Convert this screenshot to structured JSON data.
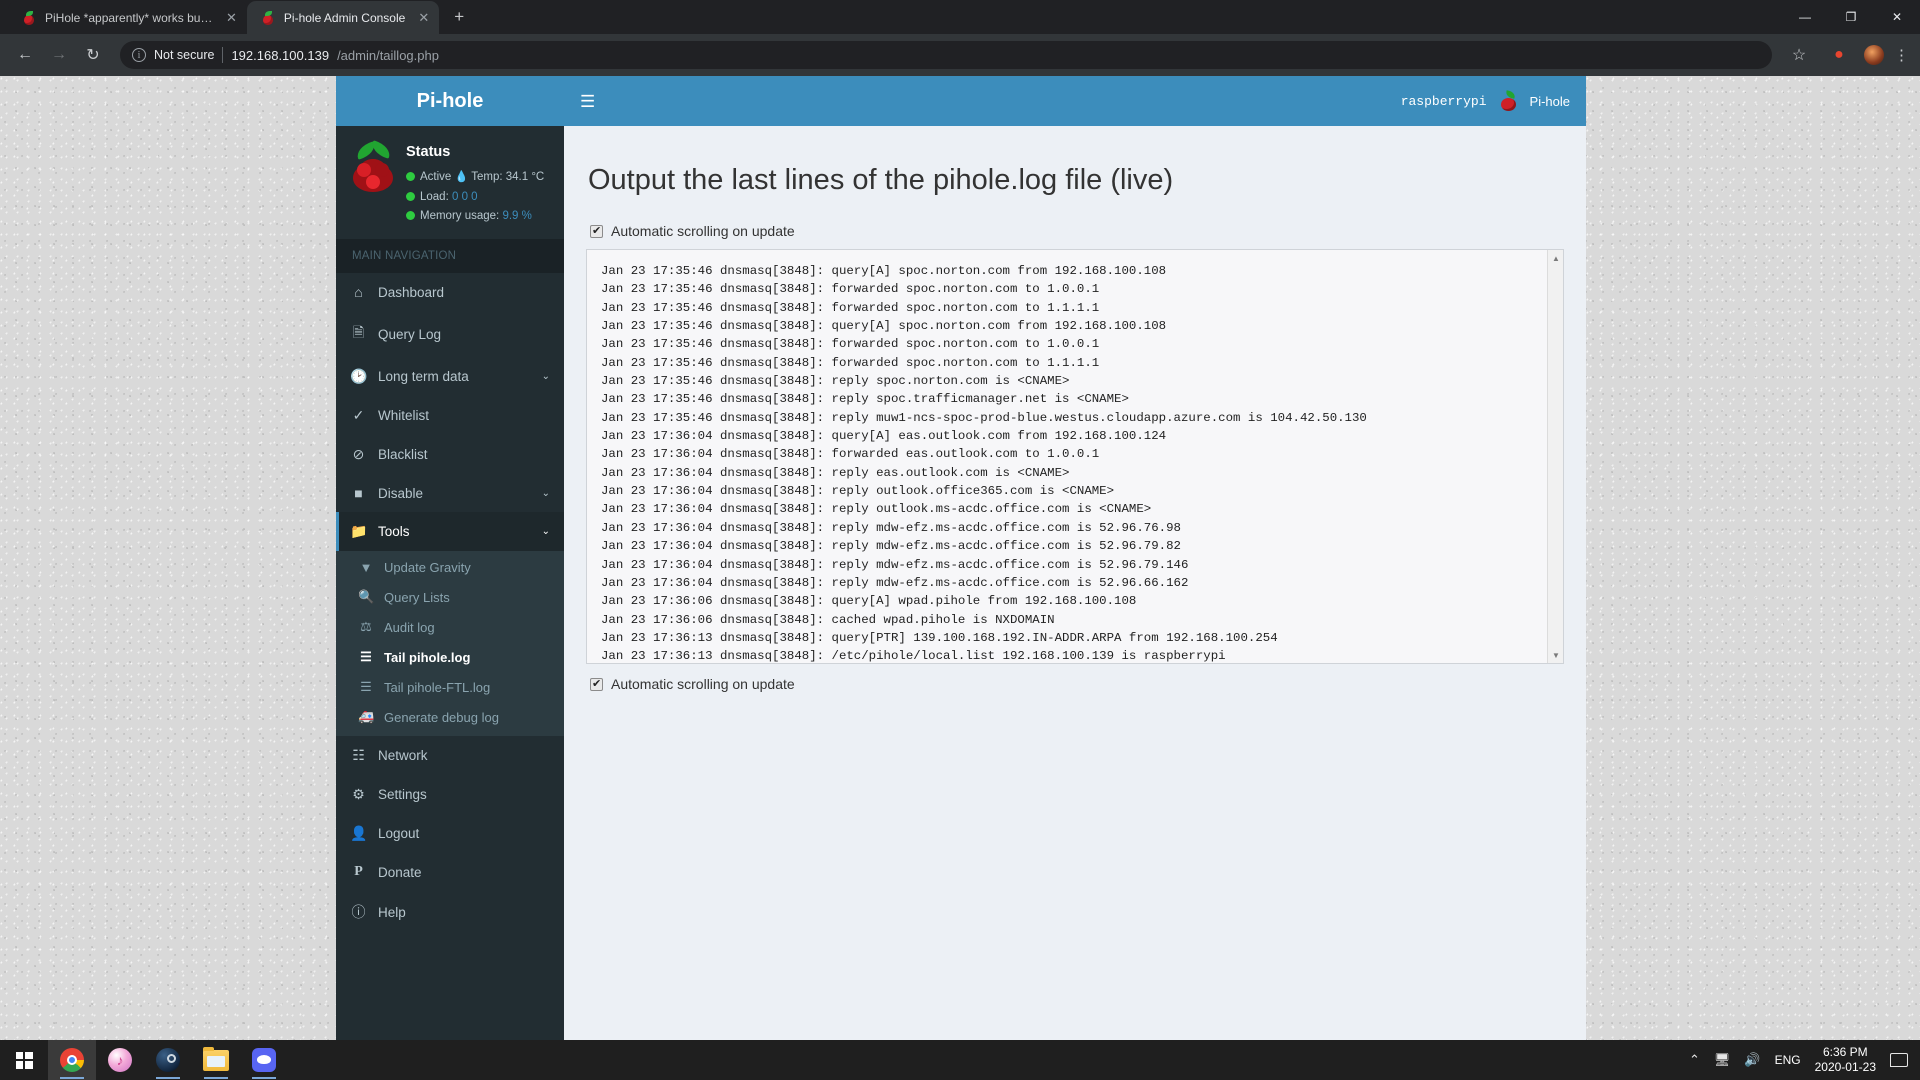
{
  "browser": {
    "tabs": [
      {
        "title": "PiHole *apparently* works but it i",
        "active": false,
        "favicon": "pihole-favicon"
      },
      {
        "title": "Pi-hole Admin Console",
        "active": true,
        "favicon": "pihole-favicon"
      }
    ],
    "new_tab_label": "+",
    "window_controls": {
      "minimize": "—",
      "maximize": "❐",
      "close": "✕"
    },
    "nav": {
      "back": "←",
      "forward": "→",
      "reload": "↻"
    },
    "omnibox": {
      "security_label": "Not secure",
      "info_glyph": "i",
      "url_host": "192.168.100.139",
      "url_path": "/admin/taillog.php"
    },
    "bookmark_star": "☆",
    "menu_dots": "⋮"
  },
  "sidebar": {
    "brand": "Pi-hole",
    "status": {
      "title": "Status",
      "active_label": "Active",
      "temp_label": "Temp: 34.1 °C",
      "load_label": "Load:",
      "load_value": "0  0  0",
      "memory_label": "Memory usage:",
      "memory_value": "9.9 %"
    },
    "nav_header": "MAIN NAVIGATION",
    "items": [
      {
        "label": "Dashboard",
        "icon": "home-icon",
        "glyph": "⌂",
        "caret": ""
      },
      {
        "label": "Query Log",
        "icon": "document-icon",
        "glyph": "὜e",
        "caret": ""
      },
      {
        "label": "Long term data",
        "icon": "clock-icon",
        "glyph": "◴",
        "caret": "⌄"
      },
      {
        "label": "Whitelist",
        "icon": "check-circle-icon",
        "glyph": "✓",
        "caret": ""
      },
      {
        "label": "Blacklist",
        "icon": "ban-icon",
        "glyph": "⊘",
        "caret": ""
      },
      {
        "label": "Disable",
        "icon": "square-icon",
        "glyph": "■",
        "caret": "⌄"
      },
      {
        "label": "Tools",
        "icon": "folder-icon",
        "glyph": "▰",
        "caret": "⌄",
        "open": true
      }
    ],
    "tools_submenu": [
      {
        "label": "Update Gravity",
        "icon": "download-circle-icon",
        "glyph": "⬇",
        "active": false
      },
      {
        "label": "Query Lists",
        "icon": "search-icon",
        "glyph": "⌕",
        "active": false
      },
      {
        "label": "Audit log",
        "icon": "balance-scale-icon",
        "glyph": "⚖",
        "active": false
      },
      {
        "label": "Tail pihole.log",
        "icon": "list-icon",
        "glyph": "≡",
        "active": true
      },
      {
        "label": "Tail pihole-FTL.log",
        "icon": "list-icon",
        "glyph": "≡",
        "active": false
      },
      {
        "label": "Generate debug log",
        "icon": "ambulance-icon",
        "glyph": "⛑",
        "active": false
      }
    ],
    "items_bottom": [
      {
        "label": "Network",
        "icon": "sitemap-icon",
        "glyph": "⛓"
      },
      {
        "label": "Settings",
        "icon": "gears-icon",
        "glyph": "⚙"
      },
      {
        "label": "Logout",
        "icon": "user-times-icon",
        "glyph": "⛉"
      },
      {
        "label": "Donate",
        "icon": "paypal-icon",
        "glyph": "P"
      },
      {
        "label": "Help",
        "icon": "question-circle-icon",
        "glyph": "?"
      }
    ]
  },
  "topbar": {
    "hamburger_icon": "hamburger-icon",
    "hamburger_glyph": "☰",
    "hostname": "raspberrypi",
    "brand_label": "Pi-hole",
    "brand_icon": "pihole-logo-icon"
  },
  "page": {
    "title": "Output the last lines of the pihole.log file (live)",
    "checkbox_top_label": "Automatic scrolling on update",
    "checkbox_bottom_label": "Automatic scrolling on update",
    "checkbox_top_checked": true,
    "checkbox_bottom_checked": true,
    "log_lines": [
      "Jan 23 17:35:46 dnsmasq[3848]: query[A] spoc.norton.com from 192.168.100.108",
      "Jan 23 17:35:46 dnsmasq[3848]: forwarded spoc.norton.com to 1.0.0.1",
      "Jan 23 17:35:46 dnsmasq[3848]: forwarded spoc.norton.com to 1.1.1.1",
      "Jan 23 17:35:46 dnsmasq[3848]: query[A] spoc.norton.com from 192.168.100.108",
      "Jan 23 17:35:46 dnsmasq[3848]: forwarded spoc.norton.com to 1.0.0.1",
      "Jan 23 17:35:46 dnsmasq[3848]: forwarded spoc.norton.com to 1.1.1.1",
      "Jan 23 17:35:46 dnsmasq[3848]: reply spoc.norton.com is <CNAME>",
      "Jan 23 17:35:46 dnsmasq[3848]: reply spoc.trafficmanager.net is <CNAME>",
      "Jan 23 17:35:46 dnsmasq[3848]: reply muw1-ncs-spoc-prod-blue.westus.cloudapp.azure.com is 104.42.50.130",
      "Jan 23 17:36:04 dnsmasq[3848]: query[A] eas.outlook.com from 192.168.100.124",
      "Jan 23 17:36:04 dnsmasq[3848]: forwarded eas.outlook.com to 1.0.0.1",
      "Jan 23 17:36:04 dnsmasq[3848]: reply eas.outlook.com is <CNAME>",
      "Jan 23 17:36:04 dnsmasq[3848]: reply outlook.office365.com is <CNAME>",
      "Jan 23 17:36:04 dnsmasq[3848]: reply outlook.ms-acdc.office.com is <CNAME>",
      "Jan 23 17:36:04 dnsmasq[3848]: reply mdw-efz.ms-acdc.office.com is 52.96.76.98",
      "Jan 23 17:36:04 dnsmasq[3848]: reply mdw-efz.ms-acdc.office.com is 52.96.79.82",
      "Jan 23 17:36:04 dnsmasq[3848]: reply mdw-efz.ms-acdc.office.com is 52.96.79.146",
      "Jan 23 17:36:04 dnsmasq[3848]: reply mdw-efz.ms-acdc.office.com is 52.96.66.162",
      "Jan 23 17:36:06 dnsmasq[3848]: query[A] wpad.pihole from 192.168.100.108",
      "Jan 23 17:36:06 dnsmasq[3848]: cached wpad.pihole is NXDOMAIN",
      "Jan 23 17:36:13 dnsmasq[3848]: query[PTR] 139.100.168.192.IN-ADDR.ARPA from 192.168.100.254",
      "Jan 23 17:36:13 dnsmasq[3848]: /etc/pihole/local.list 192.168.100.139 is raspberrypi"
    ],
    "scrollbar": {
      "up_glyph": "▲",
      "down_glyph": "▼"
    }
  },
  "taskbar": {
    "start_icon": "windows-start-icon",
    "apps": [
      {
        "name": "chrome-taskbar-icon",
        "id": "ic-chrome",
        "focused": true,
        "running": true
      },
      {
        "name": "itunes-taskbar-icon",
        "id": "ic-itunes",
        "focused": false,
        "running": false
      },
      {
        "name": "steam-taskbar-icon",
        "id": "ic-steam",
        "focused": false,
        "running": true
      },
      {
        "name": "file-explorer-taskbar-icon",
        "id": "ic-folder",
        "focused": false,
        "running": true
      },
      {
        "name": "discord-taskbar-icon",
        "id": "ic-discord",
        "focused": false,
        "running": true
      }
    ],
    "tray": {
      "chevron": "⌃",
      "network_icon": "network-icon",
      "volume_icon": "volume-icon",
      "volume_glyph": "🔊",
      "language": "ENG",
      "time": "6:36 PM",
      "date": "2020-01-23"
    }
  },
  "colors": {
    "pihole_blue": "#3c8dbc",
    "sidebar_dark": "#222d32",
    "submenu_bg": "#2c3b41",
    "status_green": "#2ecc40",
    "pi_red": "#cf2027"
  }
}
